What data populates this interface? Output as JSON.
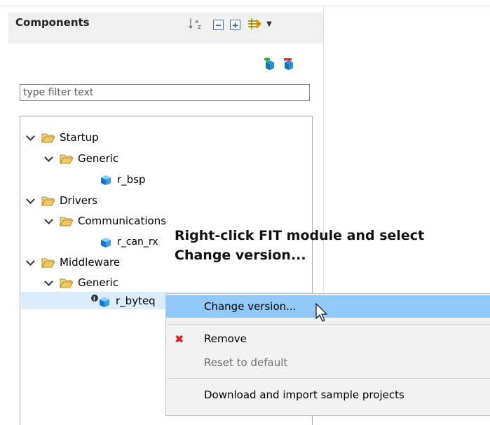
{
  "panel": {
    "title": "Components",
    "toolbar": {
      "sort_glyph": "↓ᵃz",
      "collapse_glyph": "−",
      "expand_glyph": "+",
      "arrows_glyph": "⇛",
      "dropdown_glyph": "▼"
    }
  },
  "filter": {
    "placeholder": "type filter text",
    "value": ""
  },
  "tree": {
    "items": [
      {
        "label": "Startup"
      },
      {
        "label": "Generic"
      },
      {
        "label": "r_bsp"
      },
      {
        "label": "Drivers"
      },
      {
        "label": "Communications"
      },
      {
        "label": "r_can_rx"
      },
      {
        "label": "Middleware"
      },
      {
        "label": "Generic"
      },
      {
        "label": "r_byteq"
      }
    ]
  },
  "annotation": {
    "line1": "Right-click FIT module and select",
    "line2": "Change version..."
  },
  "context_menu": {
    "change_version": "Change version...",
    "remove": "Remove",
    "reset_to_default": "Reset to default",
    "download_samples": "Download and import sample projects"
  },
  "colors": {
    "selection": "#dbecfb",
    "menu_hover": "#91c9f7",
    "folder": "#e8b84a",
    "cube": "#2a8fd6",
    "remove_x": "#d62020"
  }
}
